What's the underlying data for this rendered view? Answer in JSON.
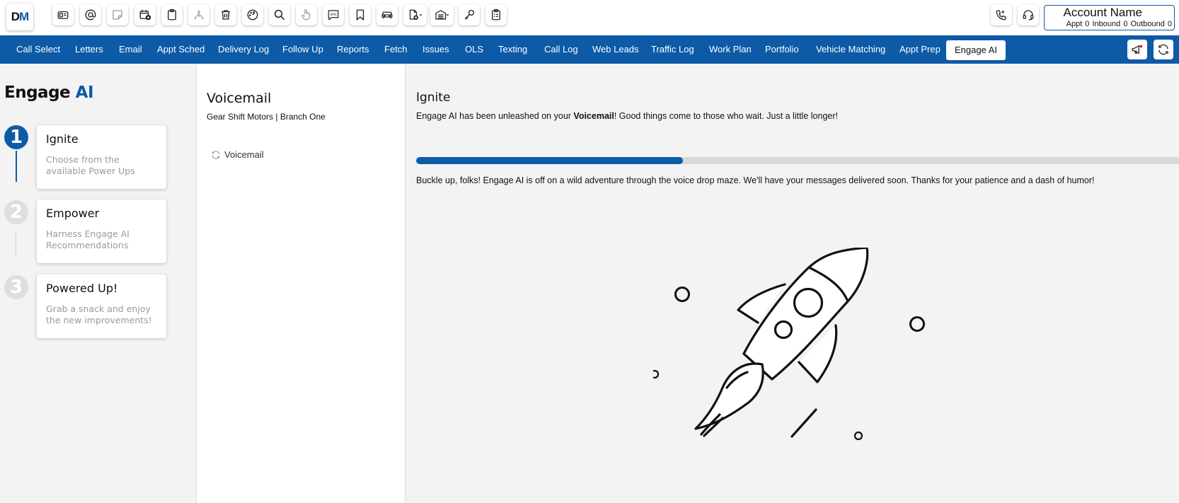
{
  "app": {
    "logo_text": "DM",
    "brand_color": "#0d5aa7"
  },
  "toolbar": {
    "icons": [
      "desk-phone-icon",
      "at-sign-icon",
      "sticky-note-icon",
      "calendar-add-icon",
      "clipboard-icon",
      "recycle-icon",
      "trash-icon",
      "speedometer-icon",
      "search-icon",
      "hand-pointer-icon",
      "sms-icon",
      "bookmark-icon",
      "car-icon",
      "new-document-icon",
      "garage-icon",
      "key-icon",
      "checklist-icon"
    ],
    "sms_label": "SMS",
    "right_icons": [
      "phone-call-icon",
      "headset-icon"
    ]
  },
  "account": {
    "name": "Account Name",
    "appt_label": "Appt 0",
    "inbound_label": "Inbound 0",
    "outbound_label": "Outbound 0"
  },
  "nav": {
    "items": [
      "Call Select",
      "Letters",
      "Email",
      "Appt Sched",
      "Delivery Log",
      "Follow Up",
      "Reports",
      "Fetch",
      "Issues",
      "OLS",
      "Texting",
      "Call Log",
      "Web Leads",
      "Traffic Log",
      "Work Plan",
      "Portfolio",
      "Vehicle Matching",
      "Appt Prep",
      "Engage AI"
    ],
    "active": "Engage AI",
    "right_icons": [
      "megaphone-icon",
      "refresh-icon"
    ]
  },
  "steps_panel": {
    "title_main": "Engage",
    "title_accent": "AI",
    "steps": [
      {
        "number": "1",
        "title": "Ignite",
        "description": "Choose from the available Power Ups",
        "state": "active"
      },
      {
        "number": "2",
        "title": "Empower",
        "description": "Harness Engage AI Recommendations",
        "state": "inactive"
      },
      {
        "number": "3",
        "title": "Powered Up!",
        "description": "Grab a snack and enjoy the new improvements!",
        "state": "inactive"
      }
    ]
  },
  "middle_panel": {
    "title": "Voicemail",
    "subtitle": "Gear Shift Motors | Branch One",
    "items": [
      {
        "label": "Voicemail",
        "icon": "sync-icon"
      }
    ]
  },
  "main_panel": {
    "title": "Ignite",
    "message_prefix": "Engage AI has been unleashed on your ",
    "message_bold": "Voicemail",
    "message_suffix": "! Good things come to those who wait. Just a little longer!",
    "progress_percent": 35,
    "note": "Buckle up, folks! Engage AI is off on a wild adventure through the voice drop maze. We'll have your messages delivered soon. Thanks for your patience and a dash of humor!"
  }
}
